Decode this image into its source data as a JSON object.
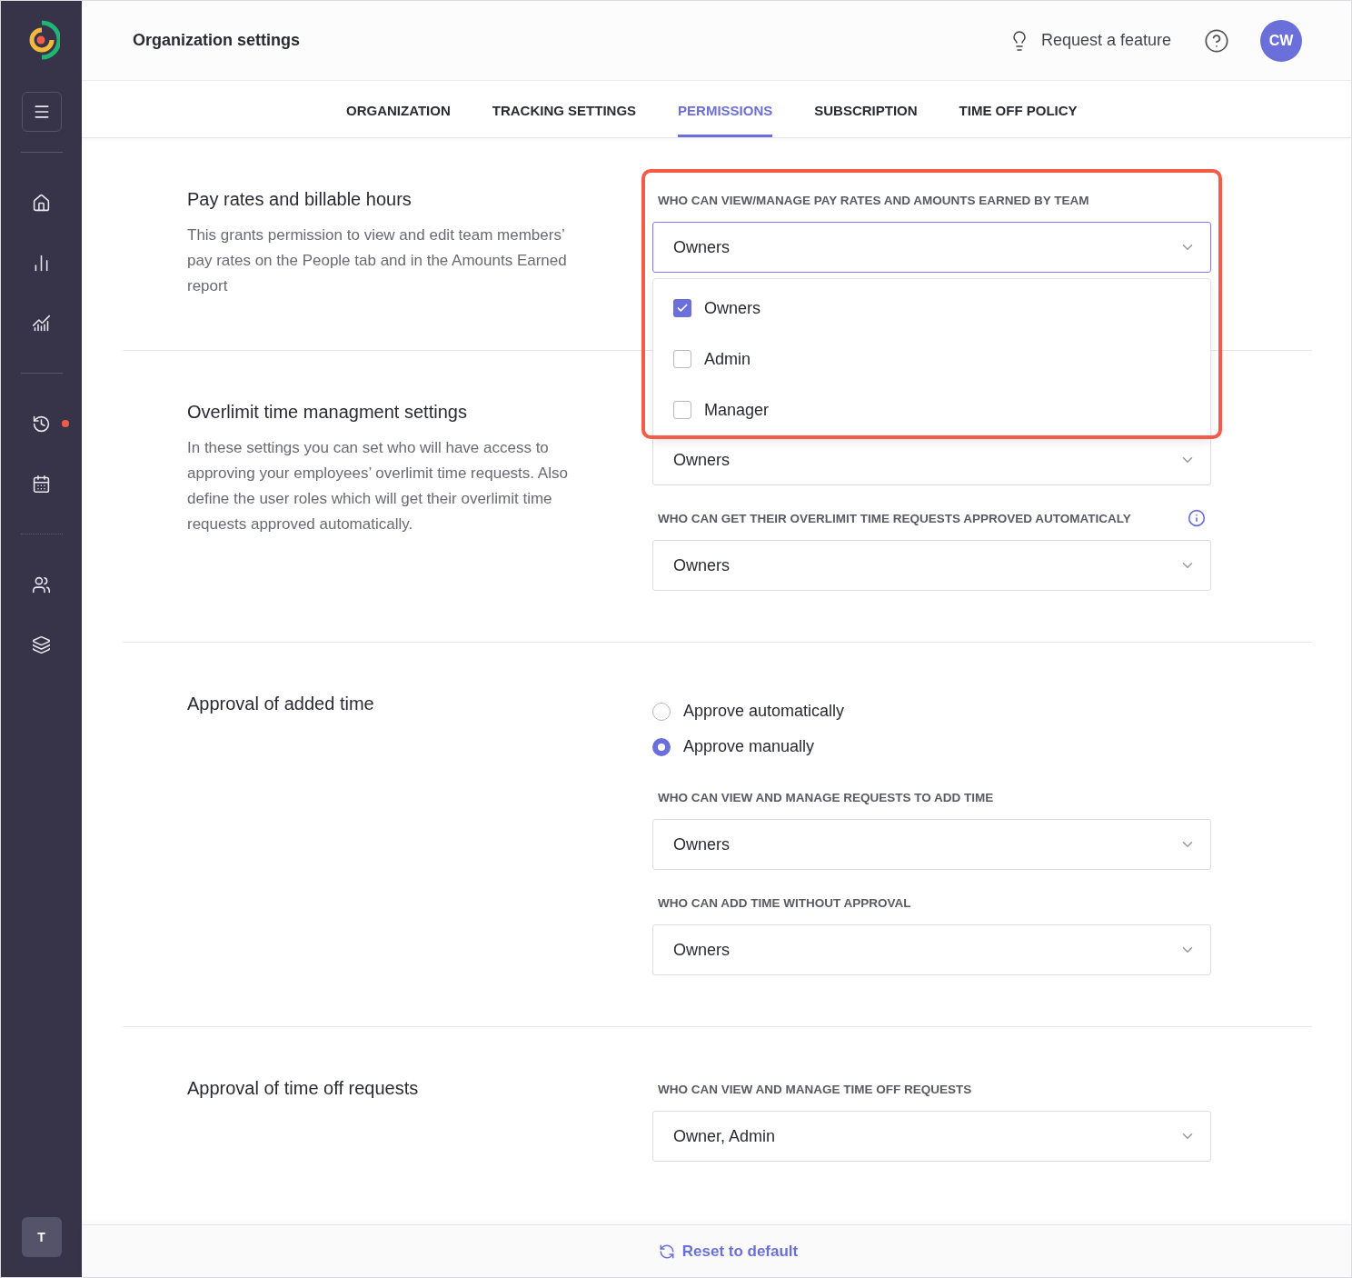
{
  "header": {
    "title": "Organization settings",
    "request_feature": "Request a feature",
    "avatar": "CW"
  },
  "sidebar": {
    "items": [
      {
        "notification": false
      },
      {
        "notification": false
      },
      {
        "notification": false
      },
      {
        "notification": true
      },
      {
        "notification": false
      },
      {
        "notification": false
      },
      {
        "notification": false
      }
    ],
    "workspace": "T"
  },
  "tabs": [
    {
      "label": "ORGANIZATION",
      "selected": false
    },
    {
      "label": "TRACKING SETTINGS",
      "selected": false
    },
    {
      "label": "PERMISSIONS",
      "selected": true
    },
    {
      "label": "SUBSCRIPTION",
      "selected": false
    },
    {
      "label": "TIME OFF POLICY",
      "selected": false
    }
  ],
  "sections": [
    {
      "title": "Pay rates and billable hours",
      "description": "This grants permission to view and edit team members’ pay rates on the People tab and in the Amounts Earned report",
      "controls": [
        {
          "kind": "select",
          "label": "WHO CAN VIEW/MANAGE PAY RATES AND AMOUNTS EARNED BY TEAM",
          "value": "Owners",
          "open": true,
          "highlighted": true,
          "options": [
            {
              "label": "Owners",
              "checked": true
            },
            {
              "label": "Admin",
              "checked": false
            },
            {
              "label": "Manager",
              "checked": false
            }
          ]
        }
      ]
    },
    {
      "title": "Overlimit time managment settings",
      "description": "In these settings you can set who will have access to approving your employees’ overlimit time requests. Also define the user roles which will get their overlimit time requests approved automatically.",
      "controls": [
        {
          "kind": "select",
          "value": "Owners",
          "open": false,
          "highlighted": false
        },
        {
          "kind": "select",
          "label": "WHO CAN GET THEIR OVERLIMIT TIME REQUESTS APPROVED AUTOMATICALY",
          "info": true,
          "value": "Owners",
          "open": false
        }
      ]
    },
    {
      "title": "Approval of added time",
      "controls": [
        {
          "kind": "radio",
          "label": "Approve automatically",
          "selected": false
        },
        {
          "kind": "radio",
          "label": "Approve manually",
          "selected": true
        },
        {
          "kind": "select",
          "label": "WHO CAN VIEW AND MANAGE REQUESTS TO ADD TIME",
          "value": "Owners",
          "open": false
        },
        {
          "kind": "select",
          "label": "WHO CAN ADD TIME WITHOUT APPROVAL",
          "value": "Owners",
          "open": false
        }
      ]
    },
    {
      "title": "Approval of time off requests",
      "controls": [
        {
          "kind": "select",
          "label": "WHO CAN VIEW AND MANAGE TIME OFF REQUESTS",
          "value": "Owner, Admin",
          "open": false
        }
      ]
    }
  ],
  "footer": {
    "reset": "Reset to default"
  }
}
